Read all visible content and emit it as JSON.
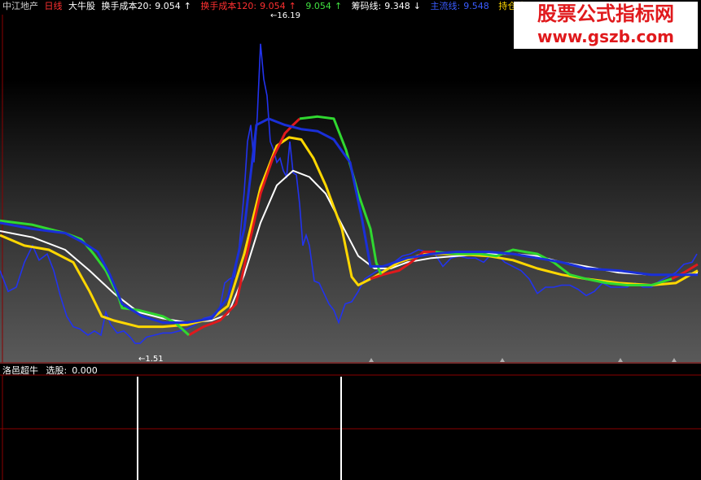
{
  "header": {
    "stock_name": "中江地产",
    "period": "日线",
    "formula": "大牛股",
    "indicators": [
      {
        "label": "换手成本20:",
        "value": "9.054",
        "arrow": "↑",
        "color": "#ffffff"
      },
      {
        "label": "换手成本120:",
        "value": "9.054",
        "arrow": "↑",
        "color": "#ff3030"
      },
      {
        "label": "",
        "value": "9.054",
        "arrow": "↑",
        "color": "#40e040"
      },
      {
        "label": "筹码线:",
        "value": "9.348",
        "arrow": "↓",
        "color": "#ffffff"
      },
      {
        "label": "主流线:",
        "value": "9.548",
        "arrow": "",
        "color": "#3a5cff"
      },
      {
        "label": "持仓线",
        "value": "",
        "arrow": "",
        "color": "#ffd700"
      }
    ]
  },
  "watermark": {
    "line1": "股票公式指标网",
    "line2": "www.gszb.com"
  },
  "sub_header": {
    "name": "洛邑超牛",
    "label": "选股:",
    "value": "0.000"
  },
  "chart_data": {
    "type": "line",
    "title": "",
    "xlabel": "",
    "ylabel": "",
    "ylim": [
      1.0,
      17.5
    ],
    "annotations": [
      {
        "text": "16.19",
        "kind": "high"
      },
      {
        "text": "1.51",
        "kind": "low"
      }
    ],
    "price_polyline": [
      [
        0,
        5.2
      ],
      [
        10,
        4.2
      ],
      [
        20,
        4.4
      ],
      [
        30,
        5.6
      ],
      [
        40,
        6.4
      ],
      [
        48,
        5.7
      ],
      [
        58,
        6.0
      ],
      [
        66,
        5.2
      ],
      [
        74,
        4.0
      ],
      [
        82,
        3.0
      ],
      [
        90,
        2.5
      ],
      [
        98,
        2.4
      ],
      [
        108,
        2.1
      ],
      [
        116,
        2.3
      ],
      [
        124,
        2.1
      ],
      [
        130,
        3.2
      ],
      [
        136,
        2.6
      ],
      [
        144,
        2.2
      ],
      [
        152,
        2.3
      ],
      [
        160,
        2.0
      ],
      [
        166,
        1.7
      ],
      [
        172,
        1.7
      ],
      [
        180,
        2.0
      ],
      [
        190,
        2.1
      ],
      [
        200,
        2.2
      ],
      [
        210,
        2.2
      ],
      [
        220,
        2.3
      ],
      [
        230,
        2.4
      ],
      [
        240,
        2.6
      ],
      [
        250,
        2.9
      ],
      [
        260,
        3.0
      ],
      [
        270,
        3.4
      ],
      [
        276,
        4.6
      ],
      [
        282,
        4.8
      ],
      [
        288,
        4.9
      ],
      [
        294,
        6.4
      ],
      [
        300,
        9.0
      ],
      [
        304,
        11.4
      ],
      [
        308,
        12.2
      ],
      [
        312,
        10.4
      ],
      [
        316,
        12.6
      ],
      [
        320,
        16.1
      ],
      [
        324,
        14.4
      ],
      [
        328,
        13.6
      ],
      [
        332,
        11.4
      ],
      [
        336,
        11.0
      ],
      [
        340,
        10.4
      ],
      [
        344,
        10.6
      ],
      [
        348,
        10.0
      ],
      [
        352,
        9.7
      ],
      [
        356,
        11.4
      ],
      [
        360,
        9.9
      ],
      [
        364,
        9.8
      ],
      [
        368,
        8.4
      ],
      [
        372,
        6.4
      ],
      [
        376,
        6.9
      ],
      [
        380,
        6.4
      ],
      [
        386,
        4.7
      ],
      [
        392,
        4.6
      ],
      [
        398,
        4.1
      ],
      [
        404,
        3.6
      ],
      [
        410,
        3.3
      ],
      [
        416,
        2.7
      ],
      [
        424,
        3.6
      ],
      [
        432,
        3.7
      ],
      [
        440,
        4.2
      ],
      [
        448,
        4.8
      ],
      [
        456,
        5.0
      ],
      [
        464,
        5.2
      ],
      [
        474,
        5.2
      ],
      [
        484,
        5.6
      ],
      [
        494,
        5.9
      ],
      [
        504,
        6.0
      ],
      [
        514,
        6.2
      ],
      [
        524,
        6.1
      ],
      [
        534,
        6.0
      ],
      [
        544,
        5.4
      ],
      [
        554,
        5.8
      ],
      [
        564,
        5.9
      ],
      [
        574,
        5.8
      ],
      [
        584,
        5.8
      ],
      [
        594,
        5.6
      ],
      [
        604,
        6.0
      ],
      [
        612,
        5.9
      ],
      [
        620,
        5.6
      ],
      [
        630,
        5.4
      ],
      [
        640,
        5.2
      ],
      [
        650,
        4.8
      ],
      [
        660,
        4.1
      ],
      [
        670,
        4.4
      ],
      [
        680,
        4.4
      ],
      [
        690,
        4.5
      ],
      [
        700,
        4.5
      ],
      [
        710,
        4.3
      ],
      [
        720,
        4.0
      ],
      [
        730,
        4.2
      ],
      [
        740,
        4.6
      ],
      [
        750,
        4.4
      ],
      [
        760,
        4.4
      ],
      [
        770,
        4.4
      ],
      [
        780,
        4.6
      ],
      [
        790,
        4.4
      ],
      [
        800,
        4.4
      ],
      [
        810,
        4.7
      ],
      [
        820,
        4.9
      ],
      [
        830,
        5.1
      ],
      [
        840,
        5.5
      ],
      [
        850,
        5.6
      ],
      [
        856,
        6.0
      ]
    ],
    "lines": [
      {
        "name": "white",
        "color": "#ffffff",
        "points": [
          [
            0,
            7.1
          ],
          [
            40,
            6.8
          ],
          [
            80,
            6.2
          ],
          [
            110,
            5.2
          ],
          [
            140,
            4.1
          ],
          [
            170,
            3.2
          ],
          [
            200,
            2.9
          ],
          [
            230,
            2.7
          ],
          [
            260,
            2.8
          ],
          [
            280,
            3.1
          ],
          [
            300,
            5.0
          ],
          [
            320,
            7.5
          ],
          [
            340,
            9.3
          ],
          [
            360,
            10.0
          ],
          [
            380,
            9.7
          ],
          [
            400,
            8.9
          ],
          [
            420,
            7.4
          ],
          [
            440,
            5.9
          ],
          [
            460,
            5.3
          ],
          [
            480,
            5.3
          ],
          [
            500,
            5.6
          ],
          [
            530,
            5.8
          ],
          [
            560,
            5.9
          ],
          [
            600,
            6.0
          ],
          [
            630,
            6.0
          ],
          [
            660,
            5.9
          ],
          [
            690,
            5.6
          ],
          [
            720,
            5.4
          ],
          [
            760,
            5.1
          ],
          [
            800,
            5.0
          ],
          [
            840,
            5.0
          ],
          [
            857,
            5.1
          ]
        ]
      },
      {
        "name": "yellow",
        "color": "#ffd700",
        "points": [
          [
            0,
            6.9
          ],
          [
            30,
            6.4
          ],
          [
            60,
            6.2
          ],
          [
            90,
            5.6
          ],
          [
            110,
            4.2
          ],
          [
            125,
            3.0
          ],
          [
            140,
            2.8
          ],
          [
            170,
            2.5
          ],
          [
            200,
            2.5
          ],
          [
            230,
            2.6
          ],
          [
            260,
            2.9
          ],
          [
            280,
            3.5
          ],
          [
            300,
            6.0
          ],
          [
            320,
            9.2
          ],
          [
            340,
            11.2
          ],
          [
            355,
            11.6
          ],
          [
            370,
            11.5
          ],
          [
            385,
            10.6
          ],
          [
            400,
            9.3
          ],
          [
            420,
            7.2
          ],
          [
            432,
            4.9
          ],
          [
            440,
            4.5
          ],
          [
            460,
            4.9
          ],
          [
            490,
            5.6
          ],
          [
            520,
            6.0
          ],
          [
            560,
            6.0
          ],
          [
            600,
            5.9
          ],
          [
            630,
            5.7
          ],
          [
            660,
            5.3
          ],
          [
            690,
            5.0
          ],
          [
            720,
            4.8
          ],
          [
            760,
            4.6
          ],
          [
            800,
            4.5
          ],
          [
            830,
            4.6
          ],
          [
            857,
            5.2
          ]
        ]
      },
      {
        "name": "red",
        "color": "#e0191c",
        "points": [
          [
            232,
            2.1
          ],
          [
            250,
            2.5
          ],
          [
            270,
            2.8
          ],
          [
            290,
            3.6
          ],
          [
            305,
            6.3
          ],
          [
            320,
            8.9
          ],
          [
            335,
            10.6
          ],
          [
            350,
            11.8
          ],
          [
            360,
            12.2
          ],
          [
            368,
            12.5
          ]
        ]
      },
      {
        "name": "red2",
        "color": "#e0191c",
        "points": [
          [
            455,
            4.8
          ],
          [
            470,
            5.0
          ],
          [
            490,
            5.2
          ],
          [
            505,
            5.6
          ],
          [
            520,
            6.1
          ],
          [
            535,
            6.1
          ]
        ]
      },
      {
        "name": "red3",
        "color": "#e0191c",
        "points": [
          [
            825,
            4.8
          ],
          [
            840,
            5.1
          ],
          [
            857,
            5.5
          ]
        ]
      },
      {
        "name": "green",
        "color": "#30d830",
        "points": [
          [
            0,
            7.6
          ],
          [
            40,
            7.4
          ],
          [
            80,
            7.0
          ],
          [
            100,
            6.7
          ],
          [
            115,
            6.0
          ],
          [
            130,
            5.2
          ],
          [
            145,
            4.0
          ],
          [
            150,
            3.4
          ],
          [
            170,
            3.3
          ],
          [
            200,
            3.0
          ],
          [
            215,
            2.7
          ],
          [
            232,
            2.1
          ]
        ]
      },
      {
        "name": "green2",
        "color": "#30d830",
        "points": [
          [
            368,
            12.5
          ],
          [
            390,
            12.6
          ],
          [
            410,
            12.5
          ],
          [
            425,
            11.0
          ],
          [
            440,
            8.9
          ],
          [
            455,
            7.2
          ],
          [
            462,
            5.6
          ],
          [
            468,
            5.0
          ]
        ]
      },
      {
        "name": "green3",
        "color": "#30d830",
        "points": [
          [
            535,
            6.1
          ],
          [
            560,
            6.0
          ],
          [
            590,
            6.0
          ],
          [
            610,
            5.9
          ],
          [
            630,
            6.2
          ],
          [
            660,
            6.0
          ],
          [
            680,
            5.6
          ],
          [
            700,
            5.0
          ],
          [
            720,
            4.8
          ],
          [
            745,
            4.6
          ],
          [
            770,
            4.5
          ],
          [
            800,
            4.5
          ],
          [
            825,
            4.8
          ]
        ]
      },
      {
        "name": "blue",
        "color": "#1a2fd8",
        "points": [
          [
            0,
            7.5
          ],
          [
            40,
            7.2
          ],
          [
            80,
            7.0
          ],
          [
            100,
            6.6
          ],
          [
            120,
            6.1
          ],
          [
            135,
            5.0
          ],
          [
            150,
            3.6
          ],
          [
            175,
            3.0
          ],
          [
            200,
            2.7
          ],
          [
            230,
            2.7
          ],
          [
            260,
            2.9
          ],
          [
            280,
            3.9
          ],
          [
            300,
            7.2
          ],
          [
            315,
            12.2
          ],
          [
            330,
            12.5
          ],
          [
            350,
            12.2
          ],
          [
            370,
            12.0
          ],
          [
            390,
            11.9
          ],
          [
            410,
            11.5
          ],
          [
            430,
            10.4
          ],
          [
            445,
            7.6
          ],
          [
            455,
            5.4
          ],
          [
            470,
            5.4
          ],
          [
            500,
            5.8
          ],
          [
            530,
            6.0
          ],
          [
            560,
            6.1
          ],
          [
            600,
            6.1
          ],
          [
            630,
            6.0
          ],
          [
            660,
            5.8
          ],
          [
            690,
            5.6
          ],
          [
            720,
            5.3
          ],
          [
            760,
            5.2
          ],
          [
            800,
            5.0
          ],
          [
            840,
            5.0
          ],
          [
            857,
            5.0
          ]
        ]
      }
    ],
    "sub_bars": [
      {
        "x": 168,
        "value": 1
      },
      {
        "x": 418,
        "value": 1
      }
    ],
    "markers": [
      {
        "x": 456
      },
      {
        "x": 617
      },
      {
        "x": 762
      },
      {
        "x": 828
      }
    ]
  },
  "colors": {
    "header_name": "#cfcfcf",
    "header_period": "#ff3030",
    "header_formula": "#ffffff",
    "sub_bar": "#ffffff",
    "grid": "#8b0000"
  }
}
